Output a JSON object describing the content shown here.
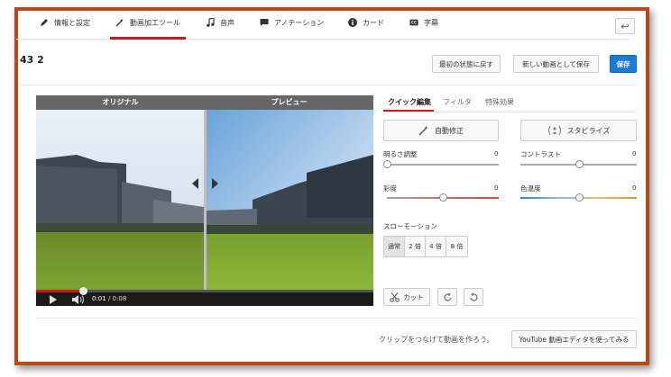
{
  "tabs": [
    {
      "label": "情報と設定",
      "icon": "pencil-icon"
    },
    {
      "label": "動画加工ツール",
      "icon": "magic-wand-icon",
      "active": true
    },
    {
      "label": "音声",
      "icon": "music-note-icon"
    },
    {
      "label": "アノテーション",
      "icon": "speech-bubble-icon"
    },
    {
      "label": "カード",
      "icon": "info-icon"
    },
    {
      "label": "字幕",
      "icon": "cc-icon"
    }
  ],
  "back_button": {
    "icon": "back-arrow-icon",
    "symbol": "↩"
  },
  "video": {
    "title": "43 2"
  },
  "header_buttons": {
    "revert": "最初の状態に戻す",
    "save_as_new": "新しい動画として保存",
    "save": "保存"
  },
  "player": {
    "original_label": "オリジナル",
    "preview_label": "プレビュー",
    "current_time": "0:01",
    "duration": "/ 0:08",
    "progress": 0.14
  },
  "subtabs": {
    "quick_fix": "クイック編集",
    "filters": "フィルタ",
    "effects": "特殊効果"
  },
  "auto_fix_label": "自動修正",
  "stabilize_label": "スタビライズ",
  "sliders": {
    "brightness": {
      "label": "明るさ調整",
      "value": "0",
      "level": 0.0
    },
    "contrast": {
      "label": "コントラスト",
      "value": "0",
      "level": 0.5
    },
    "saturation": {
      "label": "彩度",
      "value": "0",
      "level": 0.5
    },
    "temperature": {
      "label": "色温度",
      "value": "0",
      "level": 0.5
    }
  },
  "slow_motion": {
    "label": "スローモーション",
    "options": [
      "通常",
      "2 倍",
      "4 倍",
      "8 倍"
    ],
    "selected": "通常"
  },
  "trim_label": "カット",
  "footer": {
    "text": "クリップをつなげて動画を作ろう。",
    "editor_button": "YouTube 動画エディタを使ってみる"
  },
  "colors": {
    "accent_red": "#cc181e",
    "primary_blue": "#1b7bd6",
    "frame_orange": "#b84a1a"
  }
}
